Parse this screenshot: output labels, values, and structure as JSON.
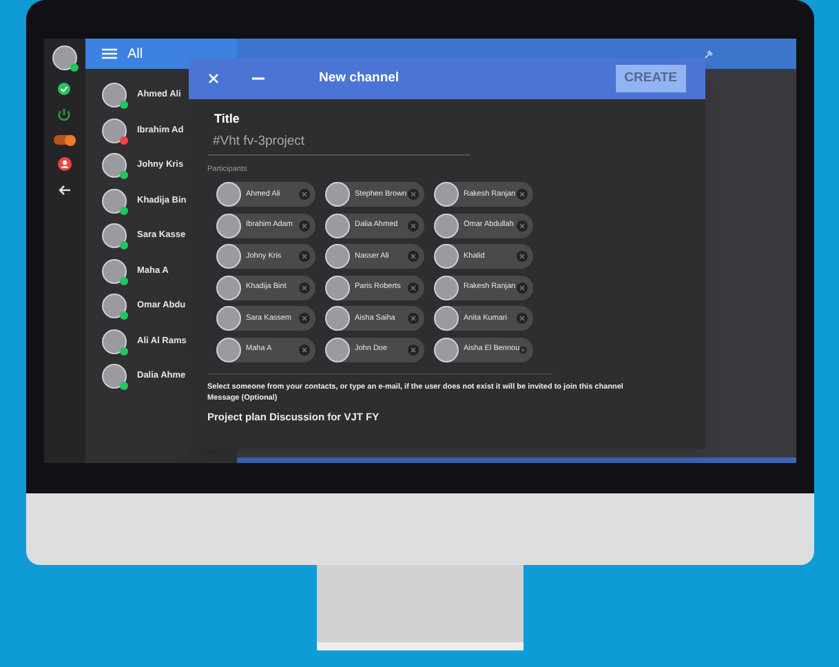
{
  "rail": {
    "toggle": {
      "on": true
    }
  },
  "contacts": {
    "header": "All",
    "items": [
      {
        "name": "Ahmed Ali",
        "color": "#22c55e"
      },
      {
        "name": "Ibrahim Ad",
        "color": "#ef4444"
      },
      {
        "name": "Johny Kris",
        "color": "#22c55e"
      },
      {
        "name": "Khadija Bin",
        "color": "#22c55e"
      },
      {
        "name": "Sara Kasse",
        "color": "#22c55e"
      },
      {
        "name": "Maha A",
        "color": "#22c55e"
      },
      {
        "name": "Omar Abdu",
        "color": "#22c55e"
      },
      {
        "name": "Ali Al Rams",
        "color": "#22c55e"
      },
      {
        "name": "Dalia Ahme",
        "color": "#22c55e"
      }
    ]
  },
  "dialog": {
    "title": "New channel",
    "create_button": {
      "label": "CREATE",
      "disabled": true
    },
    "title_label": "Title",
    "title_value": "#Vht fv-3project",
    "participants_label": "Participants",
    "participants": [
      {
        "name": "Ahmed Ali"
      },
      {
        "name": "Stephen Brown"
      },
      {
        "name": "Rakesh Ranjan"
      },
      {
        "name": "Ibrahim Adam"
      },
      {
        "name": "Dalia Ahmed"
      },
      {
        "name": "Omar Abdullah"
      },
      {
        "name": "Johny Kris"
      },
      {
        "name": "Nasser Ali"
      },
      {
        "name": "Khalid"
      },
      {
        "name": "Khadija Bint"
      },
      {
        "name": "Paris Roberts"
      },
      {
        "name": "Rakesh Ranjan"
      },
      {
        "name": "Sara Kassem"
      },
      {
        "name": "Aisha Saiha"
      },
      {
        "name": "Anita Kumari"
      },
      {
        "name": "Maha A"
      },
      {
        "name": "John Doe"
      },
      {
        "name": "Aisha El Bennou"
      }
    ],
    "hint": "Select someone from your contacts, or type an e-mail, if the user does not exist it will be invited to join this channel",
    "message_label": "Message (Optional)",
    "message_value": "Project plan Discussion for VJT FY"
  }
}
